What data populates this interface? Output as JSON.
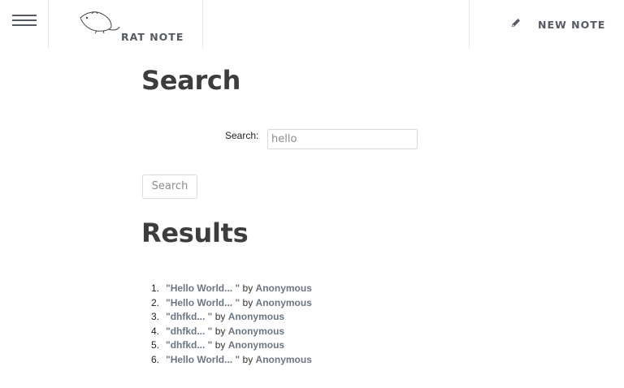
{
  "header": {
    "brand_label": "RAT NOTE",
    "new_note_label": "NEW NOTE",
    "menu_icon": "hamburger-menu-icon",
    "brand_icon": "rat-logo",
    "new_note_icon": "pencil-icon"
  },
  "main": {
    "search_heading": "Search",
    "search_label": "Search:",
    "search_value": "hello",
    "search_button": "Search",
    "results_heading": "Results",
    "by_word": "by",
    "results": [
      {
        "num": "1.",
        "title": "\"Hello World... \"",
        "author": "Anonymous"
      },
      {
        "num": "2.",
        "title": "\"Hello World... \"",
        "author": "Anonymous"
      },
      {
        "num": "3.",
        "title": "\"dhfkd... \"",
        "author": "Anonymous"
      },
      {
        "num": "4.",
        "title": "\"dhfkd... \"",
        "author": "Anonymous"
      },
      {
        "num": "5.",
        "title": "\"dhfkd... \"",
        "author": "Anonymous"
      },
      {
        "num": "6.",
        "title": "\"Hello World... \"",
        "author": "Anonymous"
      }
    ]
  },
  "colors": {
    "link": "#6b7683",
    "heading": "#3d3d3d",
    "nav_text": "#555a62",
    "divider": "#e6e6e6"
  }
}
